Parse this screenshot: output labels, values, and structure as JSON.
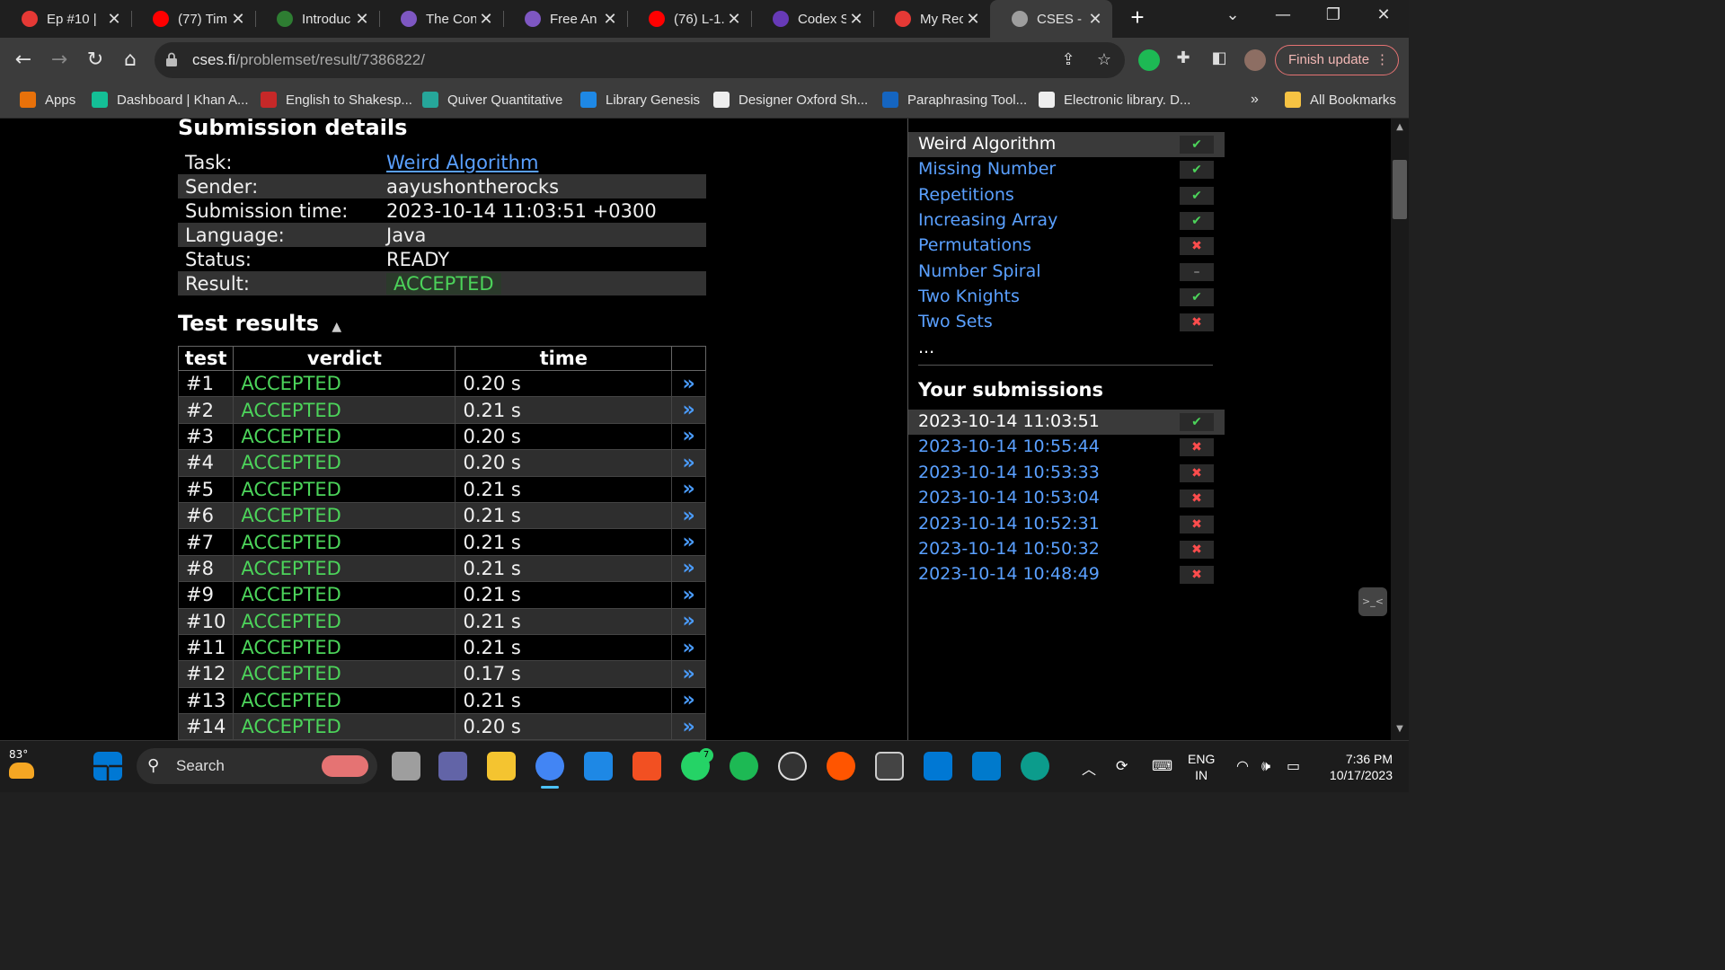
{
  "browser": {
    "tabs": [
      {
        "title": "Ep #10 |",
        "color": "#e53935"
      },
      {
        "title": "(77) Tim",
        "color": "#ff0000"
      },
      {
        "title": "Introduc",
        "color": "#2e7d32"
      },
      {
        "title": "The Con",
        "color": "#7e57c2"
      },
      {
        "title": "Free An",
        "color": "#7e57c2"
      },
      {
        "title": "(76) L-1.",
        "color": "#ff0000"
      },
      {
        "title": "Codex S",
        "color": "#673ab7"
      },
      {
        "title": "My Rece",
        "color": "#e53935"
      },
      {
        "title": "CSES - V",
        "color": "#9e9e9e"
      }
    ],
    "url_host": "cses.fi",
    "url_path": "/problemset/result/7386822/",
    "finish_update": "Finish update",
    "bookmarks": [
      {
        "label": "Apps",
        "icon": "apps-grid-icon",
        "color": "#e8710a"
      },
      {
        "label": "Dashboard | Khan A...",
        "icon": "khan-academy-icon",
        "color": "#14bf96"
      },
      {
        "label": "English to Shakesp...",
        "icon": "shakespeare-icon",
        "color": "#c62828"
      },
      {
        "label": "Quiver Quantitative",
        "icon": "quiver-icon",
        "color": "#26a69a"
      },
      {
        "label": "Library Genesis",
        "icon": "library-icon",
        "color": "#1e88e5"
      },
      {
        "label": "Designer Oxford Sh...",
        "icon": "designer-icon",
        "color": "#eeeeee"
      },
      {
        "label": "Paraphrasing Tool...",
        "icon": "paraphrase-icon",
        "color": "#1565c0"
      },
      {
        "label": "Electronic library. D...",
        "icon": "electronic-library-icon",
        "color": "#eeeeee"
      }
    ],
    "bookmarks_overflow": "»",
    "all_bookmarks": "All Bookmarks"
  },
  "submission": {
    "heading": "Submission details",
    "rows": [
      {
        "label": "Task:",
        "value": "Weird Algorithm",
        "link": true
      },
      {
        "label": "Sender:",
        "value": "aayushontherocks"
      },
      {
        "label": "Submission time:",
        "value": "2023-10-14 11:03:51 +0300"
      },
      {
        "label": "Language:",
        "value": "Java"
      },
      {
        "label": "Status:",
        "value": "READY"
      },
      {
        "label": "Result:",
        "value": "ACCEPTED",
        "badge": true
      }
    ]
  },
  "tests": {
    "heading": "Test results",
    "toggle_icon": "▲",
    "columns": [
      "test",
      "verdict",
      "time",
      ""
    ],
    "rows": [
      {
        "test": "#1",
        "verdict": "ACCEPTED",
        "time": "0.20 s"
      },
      {
        "test": "#2",
        "verdict": "ACCEPTED",
        "time": "0.21 s"
      },
      {
        "test": "#3",
        "verdict": "ACCEPTED",
        "time": "0.20 s"
      },
      {
        "test": "#4",
        "verdict": "ACCEPTED",
        "time": "0.20 s"
      },
      {
        "test": "#5",
        "verdict": "ACCEPTED",
        "time": "0.21 s"
      },
      {
        "test": "#6",
        "verdict": "ACCEPTED",
        "time": "0.21 s"
      },
      {
        "test": "#7",
        "verdict": "ACCEPTED",
        "time": "0.21 s"
      },
      {
        "test": "#8",
        "verdict": "ACCEPTED",
        "time": "0.21 s"
      },
      {
        "test": "#9",
        "verdict": "ACCEPTED",
        "time": "0.21 s"
      },
      {
        "test": "#10",
        "verdict": "ACCEPTED",
        "time": "0.21 s"
      },
      {
        "test": "#11",
        "verdict": "ACCEPTED",
        "time": "0.21 s"
      },
      {
        "test": "#12",
        "verdict": "ACCEPTED",
        "time": "0.17 s"
      },
      {
        "test": "#13",
        "verdict": "ACCEPTED",
        "time": "0.21 s"
      },
      {
        "test": "#14",
        "verdict": "ACCEPTED",
        "time": "0.20 s"
      }
    ],
    "view_glyph": "»"
  },
  "sidebar": {
    "tasks": [
      {
        "name": "Weird Algorithm",
        "status": "ok",
        "current": true
      },
      {
        "name": "Missing Number",
        "status": "ok"
      },
      {
        "name": "Repetitions",
        "status": "ok"
      },
      {
        "name": "Increasing Array",
        "status": "ok"
      },
      {
        "name": "Permutations",
        "status": "bad"
      },
      {
        "name": "Number Spiral",
        "status": "none"
      },
      {
        "name": "Two Knights",
        "status": "ok"
      },
      {
        "name": "Two Sets",
        "status": "bad"
      }
    ],
    "more": "...",
    "submissions_heading": "Your submissions",
    "submissions": [
      {
        "time": "2023-10-14 11:03:51",
        "status": "ok",
        "current": true
      },
      {
        "time": "2023-10-14 10:55:44",
        "status": "bad"
      },
      {
        "time": "2023-10-14 10:53:33",
        "status": "bad"
      },
      {
        "time": "2023-10-14 10:53:04",
        "status": "bad"
      },
      {
        "time": "2023-10-14 10:52:31",
        "status": "bad"
      },
      {
        "time": "2023-10-14 10:50:32",
        "status": "bad"
      },
      {
        "time": "2023-10-14 10:48:49",
        "status": "bad"
      }
    ],
    "status_glyphs": {
      "ok": "✔",
      "bad": "✖",
      "none": "–"
    }
  },
  "taskbar": {
    "weather": "83°",
    "search": "Search",
    "whatsapp_badge": "7",
    "lang": "ENG",
    "region": "IN",
    "time": "7:36 PM",
    "date": "10/17/2023"
  }
}
